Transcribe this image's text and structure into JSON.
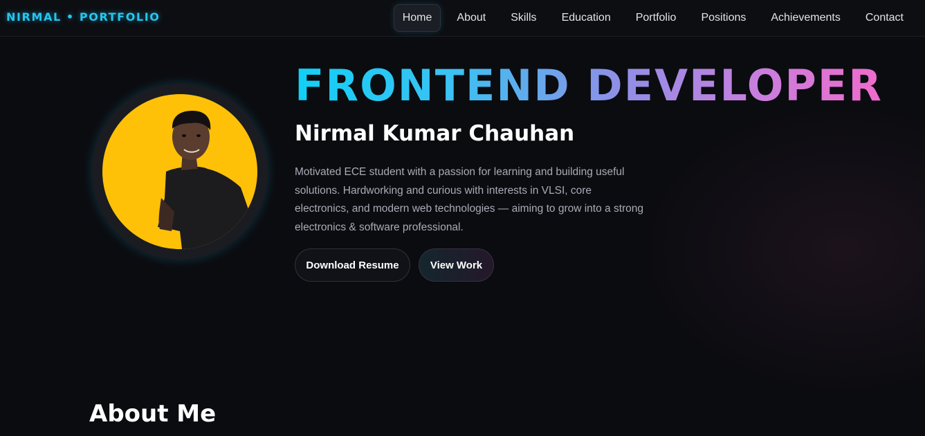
{
  "brand": "NIRMAL • PORTFOLIO",
  "nav": {
    "items": [
      "Home",
      "About",
      "Skills",
      "Education",
      "Portfolio",
      "Positions",
      "Achievements",
      "Contact"
    ],
    "active": "Home"
  },
  "hero": {
    "title": "FRONTEND DEVELOPER",
    "name": "Nirmal Kumar Chauhan",
    "description": "Motivated ECE student with a passion for learning and building useful solutions. Hardworking and curious with interests in VLSI, core electronics, and modern web technologies — aiming to grow into a strong electronics & software professional.",
    "buttons": {
      "resume": "Download Resume",
      "work": "View Work"
    },
    "avatar_icon": "profile-photo"
  },
  "about": {
    "title": "About Me"
  },
  "colors": {
    "background": "#0b0c10",
    "accent_cyan": "#25c6f0",
    "accent_pink": "#f06bcb",
    "avatar_bg": "#ffc107"
  }
}
